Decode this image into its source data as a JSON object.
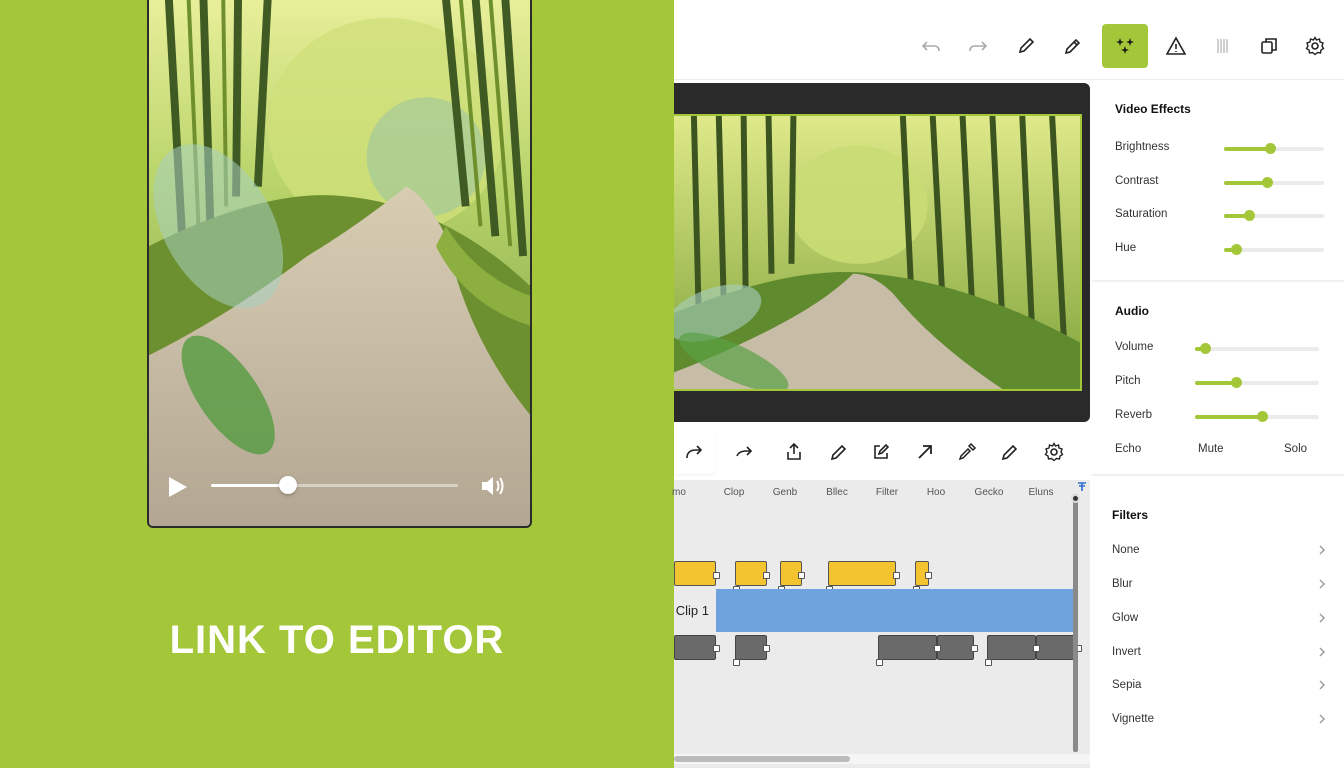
{
  "colors": {
    "accent": "#a4c639",
    "clip_yellow": "#f4c430",
    "clip_blue": "#6fa3dd",
    "clip_gray": "#6a6a6a"
  },
  "promo": {
    "cta": "LINK TO EDITOR",
    "player": {
      "progress": 0.31,
      "play_icon": "play-icon",
      "volume_icon": "volume-icon"
    }
  },
  "toolbar": {
    "buttons": [
      "undo-icon",
      "redo-icon",
      "pen-icon",
      "pencil-icon",
      "sparkle-effects-icon",
      "warning-triangle-icon",
      "bars-icon",
      "copy-icon",
      "gear-icon"
    ],
    "active": "sparkle-effects-icon"
  },
  "edit_tools": [
    "redo-arrow-icon",
    "forward-arrow-icon",
    "share-upload-icon",
    "pencil-icon",
    "edit-box-icon",
    "diagonal-arrow-icon",
    "eyedropper-icon",
    "pen-icon",
    "gear-icon"
  ],
  "timeline": {
    "labels": [
      "mo",
      "Clop",
      "Genb",
      "Bllec",
      "Filter",
      "Hoo",
      "Gecko",
      "Eluns"
    ],
    "clip1": "Clip 1"
  },
  "video_effects": {
    "title": "Video Effects",
    "sliders": [
      {
        "label": "Brightness",
        "value": 0.46
      },
      {
        "label": "Contrast",
        "value": 0.43
      },
      {
        "label": "Saturation",
        "value": 0.25
      },
      {
        "label": "Hue",
        "value": 0.12
      }
    ]
  },
  "audio": {
    "title": "Audio",
    "sliders": [
      {
        "label": "Volume",
        "value": 0.08
      },
      {
        "label": "Pitch",
        "value": 0.33
      },
      {
        "label": "Reverb",
        "value": 0.54
      }
    ],
    "echo": "Echo",
    "mute": "Mute",
    "solo": "Solo"
  },
  "filters": {
    "title": "Filters",
    "items": [
      "None",
      "Blur",
      "Glow",
      "Invert",
      "Sepia",
      "Vignette"
    ]
  }
}
